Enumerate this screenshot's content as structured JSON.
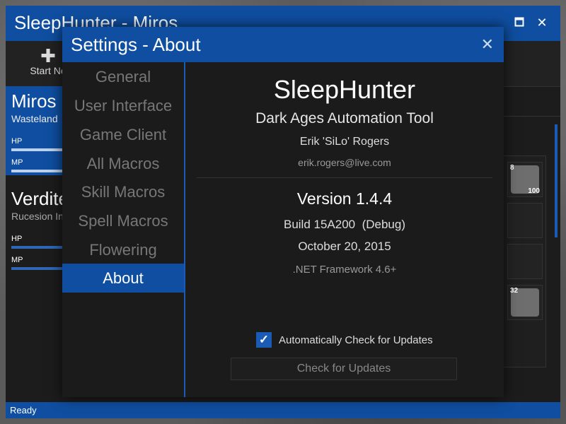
{
  "main_window": {
    "title": "SleepHunter - Miros",
    "maximize_icon": "maximize-icon",
    "close_icon": "close-icon",
    "toolbar": {
      "start_new_label": "Start Ne",
      "start_new_icon": "plus-icon"
    },
    "clients": [
      {
        "name": "Miros",
        "location": "Wasteland",
        "hp_label": "HP",
        "mp_label": "MP",
        "hp": 1.0,
        "mp": 1.0,
        "selected": true
      },
      {
        "name": "Verdite",
        "location": "Rucesion In",
        "hp_label": "HP",
        "mp_label": "MP",
        "hp": 1.0,
        "mp": 1.0,
        "selected": false
      }
    ],
    "slots": [
      {
        "top_number": "8",
        "bottom_number": "100",
        "icon": "skill-swirl-icon"
      },
      {
        "top_number": "",
        "bottom_number": "",
        "icon": ""
      },
      {
        "top_number": "",
        "bottom_number": "",
        "icon": ""
      },
      {
        "top_number": "32",
        "bottom_number": "",
        "icon": "skill-cloud-icon"
      }
    ],
    "status": "Ready"
  },
  "dialog": {
    "title": "Settings - About",
    "close_icon": "close-icon",
    "nav": [
      {
        "label": "General"
      },
      {
        "label": "User Interface"
      },
      {
        "label": "Game Client"
      },
      {
        "label": "All Macros"
      },
      {
        "label": "Skill Macros"
      },
      {
        "label": "Spell Macros"
      },
      {
        "label": "Flowering"
      },
      {
        "label": "About"
      }
    ],
    "active_nav": "About",
    "about": {
      "app_name": "SleepHunter",
      "description": "Dark Ages Automation Tool",
      "author": "Erik 'SiLo' Rogers",
      "email": "erik.rogers@live.com",
      "version": "Version 1.4.4",
      "build": "Build 15A200  (Debug)",
      "date": "October 20, 2015",
      "framework": ".NET Framework 4.6+",
      "auto_update_label": "Automatically Check for Updates",
      "auto_update_checked": true,
      "check_button_label": "Check for Updates"
    }
  },
  "colors": {
    "accent": "#0f4ea0",
    "accent_light": "#1a5cb5",
    "background": "#1b1b1b"
  }
}
